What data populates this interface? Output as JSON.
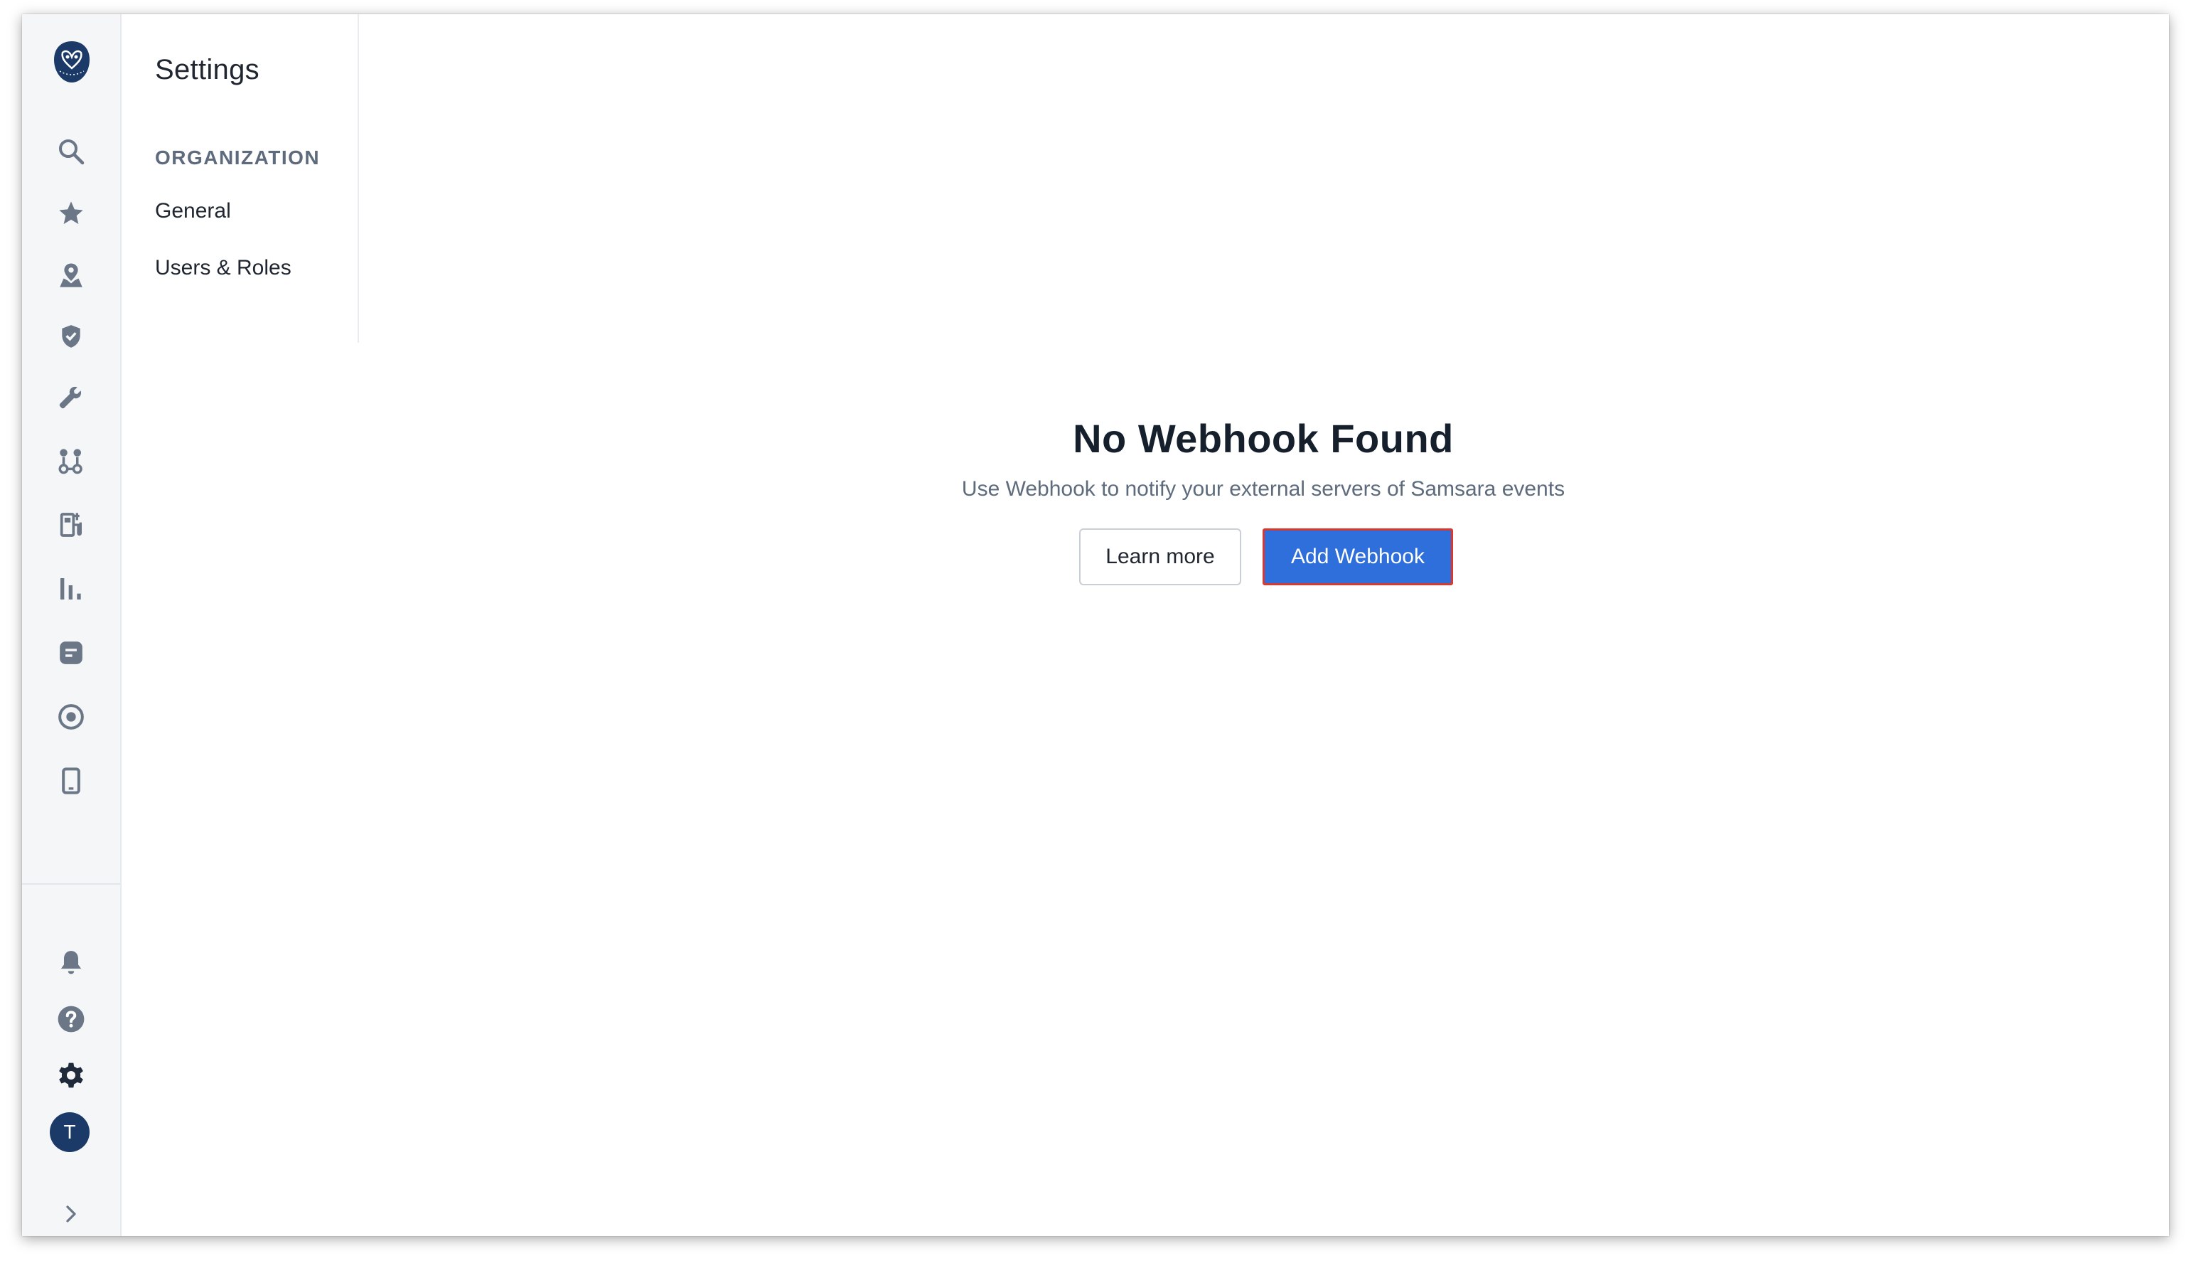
{
  "sidebar": {
    "top_icons": [
      "samsara-logo-icon",
      "search-icon",
      "star-icon",
      "map-pin-icon",
      "shield-check-icon",
      "wrench-icon",
      "route-icon",
      "fuel-icon",
      "bar-chart-icon",
      "message-icon",
      "target-icon",
      "mobile-icon"
    ],
    "bottom_icons": [
      "bell-icon",
      "help-icon",
      "gear-icon",
      "avatar",
      "chevron-right-icon"
    ],
    "avatar_initial": "T"
  },
  "settings_nav": {
    "title": "Settings",
    "section_label": "ORGANIZATION",
    "items": [
      {
        "label": "General"
      },
      {
        "label": "Users & Roles"
      }
    ]
  },
  "empty_state": {
    "title": "No Webhook Found",
    "subtitle": "Use Webhook to notify your external servers of Samsara events",
    "learn_more_label": "Learn more",
    "add_button_label": "Add Webhook"
  },
  "colors": {
    "primary_button": "#2f6fdb",
    "highlight_outline": "#d8382e",
    "rail_bg": "#f4f6f8",
    "icon_gray": "#6b7787",
    "avatar_bg": "#1b3a68"
  }
}
